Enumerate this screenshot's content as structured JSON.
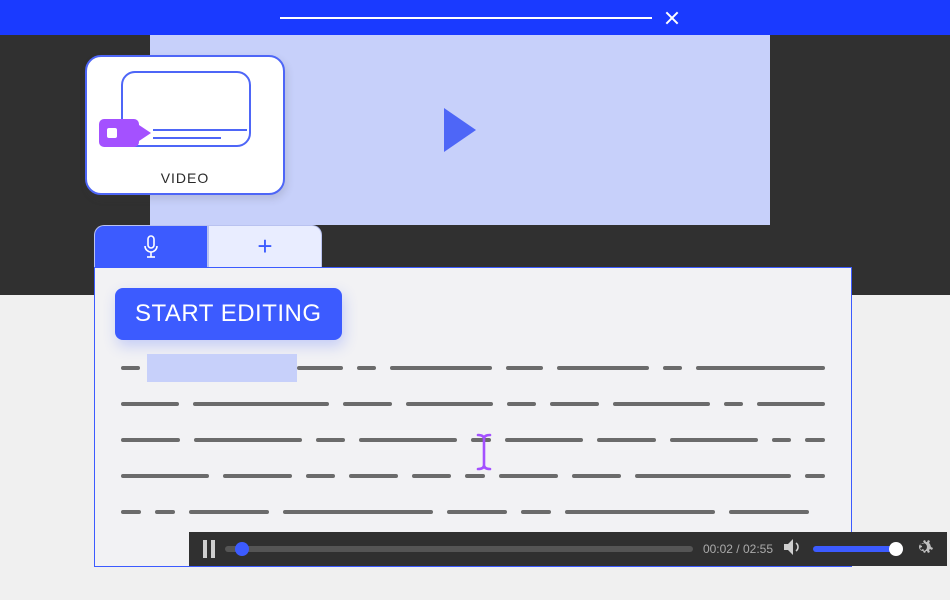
{
  "topbar": {
    "close_label": ""
  },
  "video_card": {
    "label": "VIDEO"
  },
  "tabs": {
    "plus": "+"
  },
  "editor": {
    "start_button": "START EDITING"
  },
  "player": {
    "time": "00:02 / 02:55"
  },
  "colors": {
    "brand": "#3c5bff",
    "accent": "#a451ff",
    "preview_bg": "#c7d0fa",
    "dark": "#303030"
  }
}
